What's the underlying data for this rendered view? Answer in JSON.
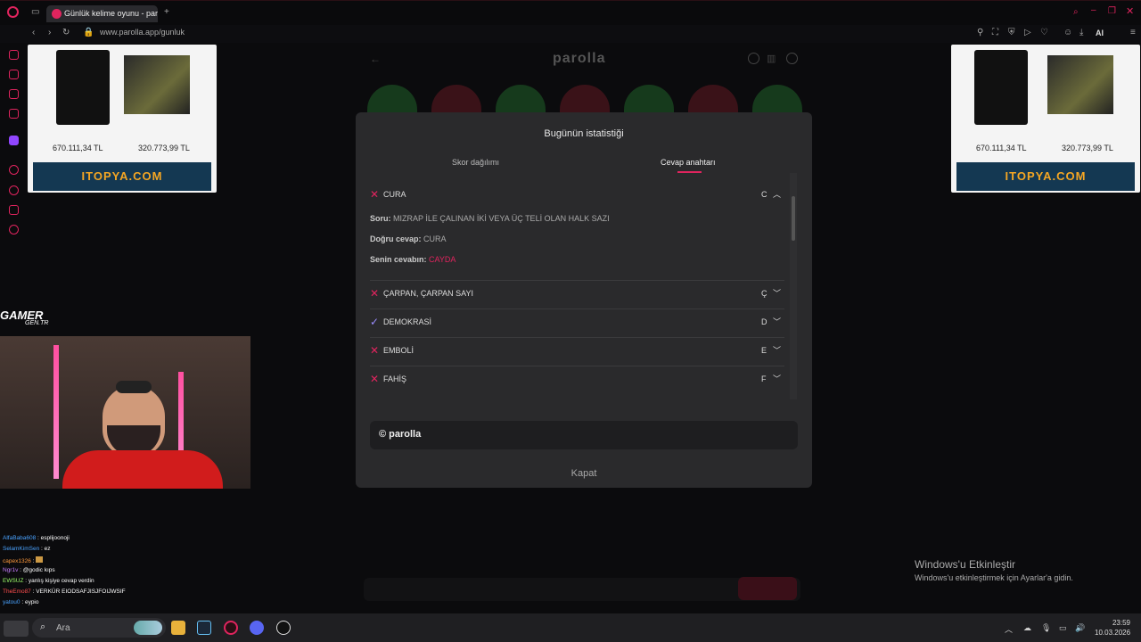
{
  "browser": {
    "tab_title": "Günlük kelime oyunu - parolla",
    "url": "www.parolla.app/gunluk",
    "ai_label": "AI"
  },
  "ads": {
    "price_1": "670.111,34 TL",
    "price_2": "320.773,99 TL",
    "brand": "ITOPYA.COM"
  },
  "page": {
    "logo": "parolla"
  },
  "modal": {
    "title": "Bugünün istatistiği",
    "tabs": [
      "Skor dağılımı",
      "Cevap anahtarı"
    ],
    "active_tab": "Cevap anahtarı",
    "expanded": {
      "word": "CURA",
      "letter": "C",
      "question_label": "Soru:",
      "question": "MIZRAP İLE ÇALINAN İKİ VEYA ÜÇ TELİ OLAN HALK SAZI",
      "correct_label": "Doğru cevap:",
      "correct": "CURA",
      "yours_label": "Senin cevabın:",
      "yours": "CAYDA"
    },
    "answers": [
      {
        "word": "ÇARPAN, ÇARPAN SAYI",
        "letter": "Ç",
        "status": "wrong"
      },
      {
        "word": "DEMOKRASİ",
        "letter": "D",
        "status": "correct"
      },
      {
        "word": "EMBOLİ",
        "letter": "E",
        "status": "wrong"
      },
      {
        "word": "FAHİŞ",
        "letter": "F",
        "status": "wrong"
      }
    ],
    "share_label": "© parolla",
    "close_label": "Kapat"
  },
  "overlay": {
    "gamer": "GAMER",
    "gamer_sub": "GEN.TR"
  },
  "chat": [
    {
      "user": "AlfaBaba608",
      "msg": ": esplijoonoji",
      "color": "#4aa3ff"
    },
    {
      "user": "SelamKimSen",
      "msg": ": ez",
      "color": "#4aa3ff"
    },
    {
      "user": "capex1326",
      "msg": ":",
      "color": "#ff9a3c"
    },
    {
      "user": "Ngr1v",
      "msg": ": @godic kıps",
      "color": "#c77dff"
    },
    {
      "user": "EWSUZ",
      "msg": ": yanlış kişiye cevap verdin",
      "color": "#9dff6a"
    },
    {
      "user": "TheEmo87",
      "msg": ": VERKÜR EIODSAFJISJFOIJWSIF",
      "color": "#ff4d4d"
    },
    {
      "user": "yatou0",
      "msg": ": eypio",
      "color": "#4aa3ff"
    }
  ],
  "windows": {
    "activate_title": "Windows'u Etkinleştir",
    "activate_sub": "Windows'u etkinleştirmek için Ayarlar'a gidin.",
    "search": "Ara",
    "time": "23:59",
    "date": "10.03.2026"
  },
  "colors": {
    "accent": "#e0245e",
    "correct": "#9b8cff",
    "wrong_answer": "#e0245e"
  }
}
